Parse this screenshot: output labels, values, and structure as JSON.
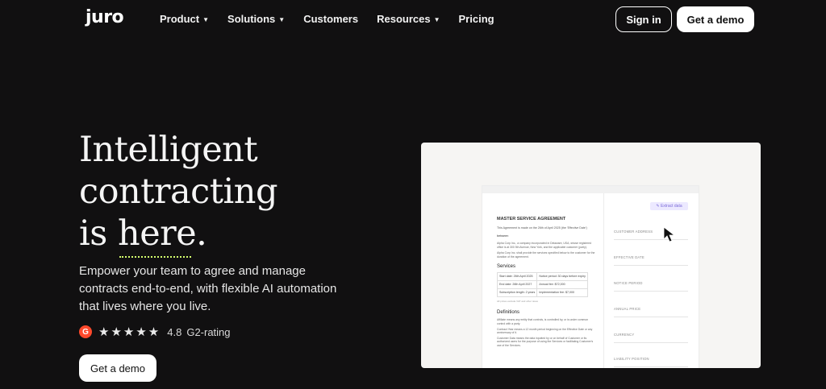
{
  "nav": {
    "logo": "juro",
    "items": [
      {
        "label": "Product",
        "caret": true
      },
      {
        "label": "Solutions",
        "caret": true
      },
      {
        "label": "Customers",
        "caret": false
      },
      {
        "label": "Resources",
        "caret": true
      },
      {
        "label": "Pricing",
        "caret": false
      }
    ],
    "signin_label": "Sign in",
    "demo_label": "Get a demo"
  },
  "hero": {
    "line1": "Intelligent",
    "line2": "contracting",
    "line3_prefix": "is ",
    "line3_word": "here",
    "line3_suffix": ".",
    "subtitle": "Empower your team to agree and manage contracts end-to-end, with flexible AI automation that lives where you live.",
    "rating_badge": "G",
    "stars": "★★★★★",
    "rating_score": "4.8",
    "rating_label": "G2-rating",
    "cta_label": "Get a demo"
  },
  "colors": {
    "background": "#111011",
    "accent_underline": "#d6ff6e",
    "g2_red": "#ff492c",
    "extract_purple": "#7b6ad8"
  },
  "preview": {
    "doc_title": "MASTER SERVICE AGREEMENT",
    "intro": "This Agreement is made on the 26th of April 2025 (the 'Effective Date')",
    "between": "between",
    "party1": "Alpha Corp Inc., a company incorporated in Delaware, USA, whose registered office is at 300 5th Avenue, New York, and the applicable customer (party).",
    "party2": "Alpha Corp Inc. shall provide the services specified below to the customer for the duration of the agreement.",
    "services_heading": "Services",
    "table": [
      [
        "Start date: 26th April 2025",
        "Notice period: 30 days before expiry"
      ],
      [
        "End date: 26th April 2027",
        "Annual fee: $72,000"
      ],
      [
        "Subscription length: 2 years",
        "Implementation fee: $7,000"
      ]
    ],
    "table_note": "All prices exclude VAT and other taxes",
    "definitions_heading": "Definitions",
    "def1": "Affiliate means any entity that controls, is controlled by, or is under common control with a party.",
    "def2": "Contract Year means a 12 month period beginning on the Effective Date or any anniversary of it.",
    "def3": "Customer Data means the data inputted by or on behalf of Customer or its authorized users for the purpose of using the Services or facilitating Customer's use of the Services.",
    "extract_label": "✎ Extract data",
    "fields": [
      "CUSTOMER ADDRESS",
      "EFFECTIVE DATE",
      "NOTICE PERIOD",
      "ANNUAL PRICE",
      "CURRENCY",
      "LIABILITY POSITION"
    ]
  }
}
